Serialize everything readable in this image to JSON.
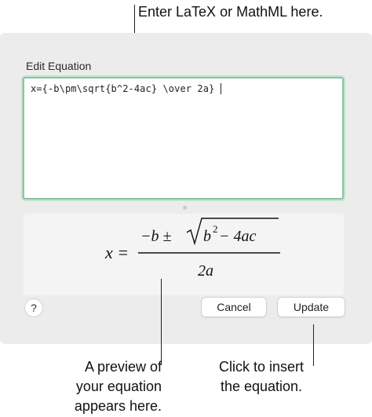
{
  "callouts": {
    "top": "Enter LaTeX or MathML here.",
    "bottom_left": [
      "A preview of",
      "your equation",
      "appears here."
    ],
    "bottom_right": [
      "Click to insert",
      "the equation."
    ]
  },
  "dialog": {
    "title": "Edit Equation",
    "editor_value": "x={-b\\pm\\sqrt{b^2-4ac} \\over 2a}",
    "preview": {
      "lhs": "x =",
      "numerator": "−b ± ",
      "radicand_base": "b",
      "radicand_exp": "2",
      "radicand_rest": " − 4ac",
      "denominator": "2a"
    },
    "help_label": "?",
    "cancel_label": "Cancel",
    "update_label": "Update"
  },
  "colors": {
    "focus_ring": "#86c6a1",
    "dialog_bg": "#ececec",
    "preview_bg": "#f4f4f4"
  }
}
